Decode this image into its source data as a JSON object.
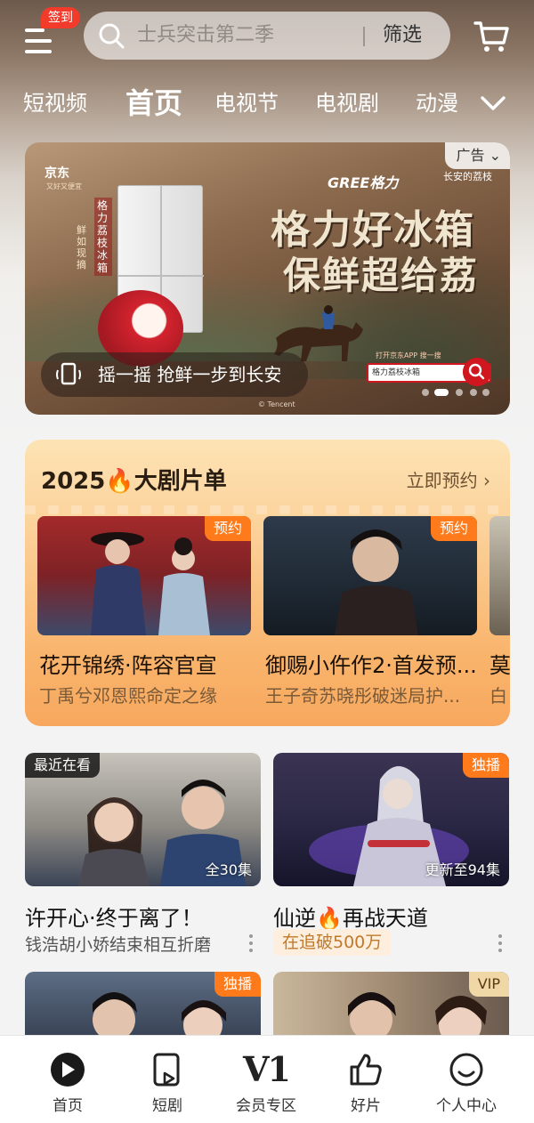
{
  "header": {
    "signin_badge": "签到",
    "search_placeholder": "士兵突击第二季",
    "filter_label": "筛选"
  },
  "tabs": [
    {
      "label": "短视频",
      "active": false
    },
    {
      "label": "首页",
      "active": true
    },
    {
      "label": "电视节",
      "active": false
    },
    {
      "label": "电视剧",
      "active": false
    },
    {
      "label": "动漫",
      "active": false
    }
  ],
  "banner": {
    "ad_label": "广告",
    "brand_jd": "京东",
    "brand_jd_sub": "又好又便宜",
    "brand_gree": "GREE格力",
    "brand_cobrand": "长安的荔枝",
    "headline_line1": "格力好冰箱",
    "headline_line2": "保鲜超给荔",
    "vertical_text": "格力荔枝冰箱",
    "vertical_text2": "鲜如现摘",
    "action_text": "摇一摇 抢鲜一步到长安",
    "jd_app_text": "打开京东APP 搜一搜",
    "jd_search_text": "格力荔枝冰箱",
    "watermark": "© Tencent"
  },
  "drama_list": {
    "title": "2025🔥大剧片单",
    "link": "立即预约 ›",
    "items": [
      {
        "badge": "预约",
        "title": "花开锦绣·阵容官宣",
        "subtitle": "丁禹兮邓恩熙命定之缘"
      },
      {
        "badge": "预约",
        "title": "御赐小仵作2·首发预...",
        "subtitle": "王子奇苏晓彤破迷局护..."
      },
      {
        "badge": "",
        "title": "莫",
        "subtitle": "白"
      }
    ]
  },
  "cards": [
    {
      "top_badge": "最近在看",
      "corner_text": "全30集",
      "title": "许开心·终于离了！",
      "subtitle": "钱浩胡小娇结束相互折磨"
    },
    {
      "top_badge": "独播",
      "corner_text": "更新至94集",
      "title": "仙逆🔥再战天道",
      "hot_text": "在追破500万"
    },
    {
      "top_badge": "独播"
    },
    {
      "top_badge": "VIP"
    }
  ],
  "bottom_nav": [
    {
      "label": "首页",
      "icon": "play-home-icon",
      "active": true
    },
    {
      "label": "短剧",
      "icon": "short-drama-icon",
      "active": false
    },
    {
      "label": "会员专区",
      "icon": "vip-icon",
      "vip_mark": "V1",
      "active": false
    },
    {
      "label": "好片",
      "icon": "thumbs-up-icon",
      "active": false
    },
    {
      "label": "个人中心",
      "icon": "smiley-icon",
      "active": false
    }
  ],
  "colors": {
    "accent_orange": "#ff7a1a",
    "signin_red": "#f33b2c",
    "hot_text": "#c0792b"
  }
}
